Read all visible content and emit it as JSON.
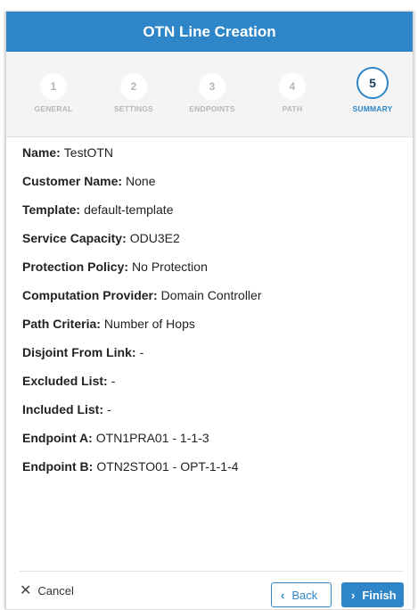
{
  "dialog": {
    "title": "OTN Line Creation"
  },
  "steps": [
    {
      "number": "1",
      "label": "GENERAL"
    },
    {
      "number": "2",
      "label": "SETTINGS"
    },
    {
      "number": "3",
      "label": "ENDPOINTS"
    },
    {
      "number": "4",
      "label": "PATH"
    },
    {
      "number": "5",
      "label": "SUMMARY",
      "active": true
    }
  ],
  "summary": [
    {
      "key": "Name:",
      "value": "TestOTN"
    },
    {
      "key": "Customer Name:",
      "value": "None"
    },
    {
      "key": "Template:",
      "value": "default-template"
    },
    {
      "key": "Service Capacity:",
      "value": "ODU3E2"
    },
    {
      "key": "Protection Policy:",
      "value": "No Protection"
    },
    {
      "key": "Computation Provider:",
      "value": "Domain Controller"
    },
    {
      "key": "Path Criteria:",
      "value": "Number of Hops"
    },
    {
      "key": "Disjoint From Link:",
      "value": "-"
    },
    {
      "key": "Excluded List:",
      "value": "-"
    },
    {
      "key": "Included List:",
      "value": "-"
    },
    {
      "key": "Endpoint A:",
      "value": "OTN1PRA01 - 1-1-3"
    },
    {
      "key": "Endpoint B:",
      "value": "OTN2STO01 - OPT-1-1-4"
    }
  ],
  "footer": {
    "cancel_label": "Cancel",
    "back_label": "Back",
    "finish_label": "Finish"
  },
  "icons": {
    "cancel": "close-icon",
    "back": "chevron-left-icon",
    "finish": "chevron-right-icon"
  },
  "colors": {
    "accent": "#2e86c8",
    "stepper_bg": "#f4f4f4",
    "inactive_step": "#b5b5b5"
  }
}
